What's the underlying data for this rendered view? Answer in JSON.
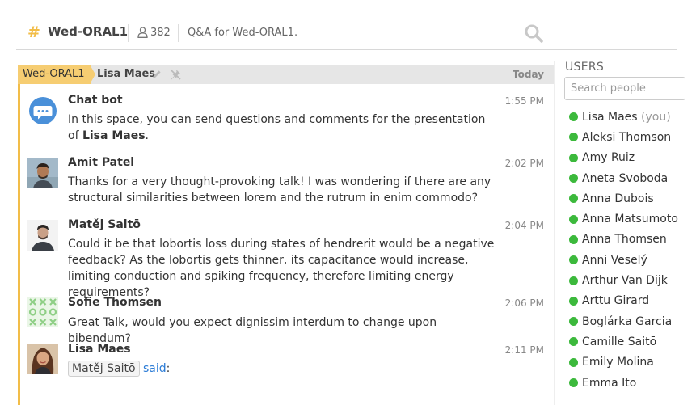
{
  "header": {
    "room_name": "Wed-ORAL1",
    "user_count": "382",
    "topic": "Q&A for Wed-ORAL1."
  },
  "chat": {
    "breadcrumb_room": "Wed-ORAL1",
    "breadcrumb_user": "Lisa Maes",
    "date_label": "Today",
    "messages": [
      {
        "author": "Chat bot",
        "time": "1:55 PM",
        "text": "In this space, you can send questions and comments for the presentation of ",
        "bold": "Lisa Maes",
        "suffix": "."
      },
      {
        "author": "Amit Patel",
        "time": "2:02 PM",
        "text": "Thanks for a very thought-provoking talk! I was wondering if there are any structural similarities between lorem and the rutrum in enim commodo?"
      },
      {
        "author": "Matěj Saitō",
        "time": "2:04 PM",
        "text": "Could it be that lobortis loss during states of hendrerit would be a negative feedback? As the lobortis gets thinner, its capacitance would increase, limiting conduction and spiking frequency, therefore limiting energy requirements?"
      },
      {
        "author": "Sofie Thomsen",
        "time": "2:06 PM",
        "text": "Great Talk, would you expect dignissim interdum to change upon bibendum?"
      },
      {
        "author": "Lisa Maes",
        "time": "2:11 PM",
        "quote_user": "Matěj Saitō",
        "said": "said",
        "colon": ":"
      }
    ]
  },
  "users": {
    "title": "USERS",
    "search_placeholder": "Search people",
    "you_label": "(you)",
    "list": [
      "Lisa Maes",
      "Aleksi Thomson",
      "Amy Ruiz",
      "Aneta Svoboda",
      "Anna Dubois",
      "Anna Matsumoto",
      "Anna Thomsen",
      "Anni Veselý",
      "Arthur Van Dijk",
      "Arttu Girard",
      "Boglárka Garcia",
      "Camille Saitō",
      "Emily Molina",
      "Emma Itō"
    ]
  },
  "colors": {
    "accent": "#f2bd49",
    "online": "#3cb93c",
    "link": "#2a7bd6"
  }
}
